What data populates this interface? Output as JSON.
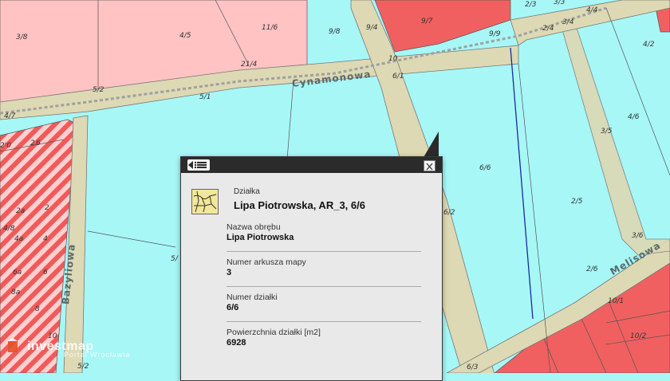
{
  "streets": {
    "cynamonowa": "Cynamonowa",
    "bazyliowa": "Bazyliowa",
    "melisowa": "Melisowa"
  },
  "parcels": {
    "p3_8": "3/8",
    "p4_5": "4/5",
    "p11_6": "11/6",
    "p9_8": "9/8",
    "p9_4": "9/4",
    "p9_7": "9/7",
    "p2_3": "2/3",
    "p3_3": "3/3",
    "p4_4": "4/4",
    "p9_9": "9/9",
    "p2_4": "2/4",
    "p3_4": "3/4",
    "p4_2": "4/2",
    "p21_4": "21/4",
    "p10": "10",
    "p6_1": "6/1",
    "p5_2": "5/2",
    "p5_1": "5/1",
    "p4_7": "4/7",
    "p2_6a": "2",
    "p2_6b": "6",
    "p2_0": "2'0",
    "p3_5": "3/5",
    "p4_6": "4/6",
    "p6_6": "6/6",
    "p6_2": "6/2",
    "p2_5": "2/5",
    "p2_6": "2/6",
    "p3_6": "3/6",
    "p10_1": "10/1",
    "p10_2": "10/2",
    "p2a": "2a",
    "p2": "2",
    "p4_8": "4/8",
    "p4a": "4a",
    "p4": "4",
    "p6a": "6a",
    "p6": "6",
    "p8a": "8a",
    "p8": "8",
    "p10b": "10",
    "p5_left": "5/",
    "p6_3": "6/3",
    "p5_2b": "5/2"
  },
  "popup": {
    "type_label": "Działka",
    "title": "Lipa Piotrowska, AR_3, 6/6",
    "fields": [
      {
        "label": "Nazwa obrębu",
        "value": "Lipa Piotrowska"
      },
      {
        "label": "Numer arkusza mapy",
        "value": "3"
      },
      {
        "label": "Numer działki",
        "value": "6/6"
      },
      {
        "label": "Powierzchnia działki [m2]",
        "value": "6928"
      }
    ],
    "list_icon": "list-icon",
    "close_icon": "close-icon",
    "parcel_icon": "parcel-map-icon"
  },
  "watermark": {
    "brand": "investmap",
    "sub": "Portal Wrocławia"
  },
  "colors": {
    "residential": "#a7f7f7",
    "light_pink": "#ffc3c3",
    "red": "#f06060",
    "road": "#ddd9b4",
    "popup_bg": "#e9e9e9",
    "popup_header": "#2b2b2b"
  }
}
